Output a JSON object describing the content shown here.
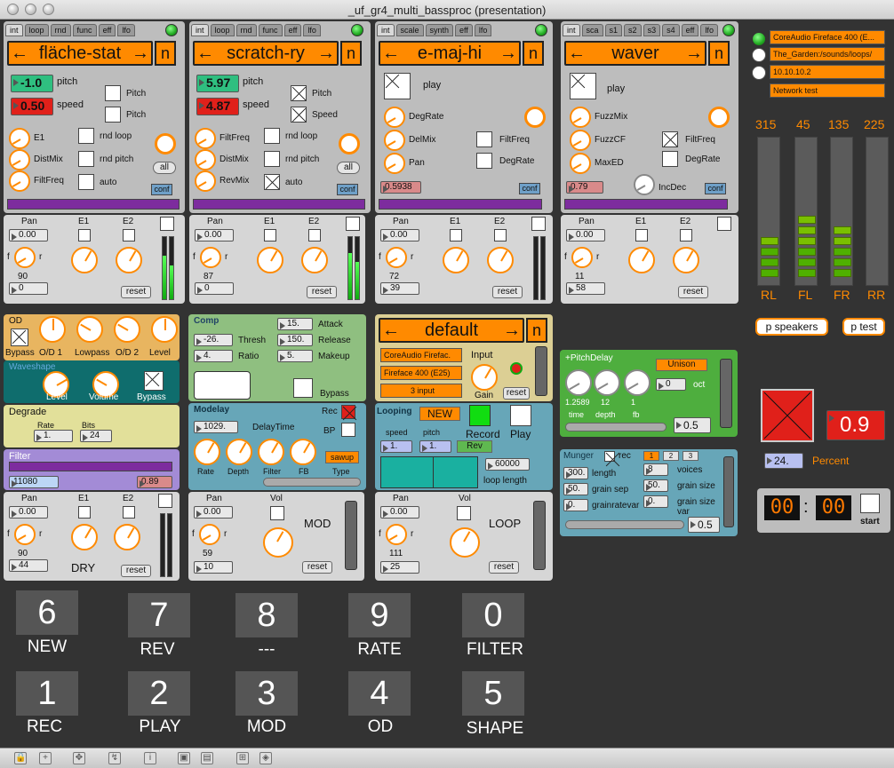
{
  "window": {
    "title": "_uf_gr4_multi_bassproc (presentation)"
  },
  "colors": {
    "accent": "#ff8a00",
    "meter": "#33cc33",
    "panel_gray": "#bdbdbd"
  },
  "modules": [
    {
      "tabs": [
        "int",
        "loop",
        "rnd",
        "func",
        "eff",
        "lfo"
      ],
      "name": "fläche-stat",
      "n": "n",
      "val1": "-1.0",
      "val1_label": "pitch",
      "val2": "0.50",
      "val2_label": "speed",
      "chk_labels": [
        "Pitch",
        "Pitch"
      ],
      "knob_labels": [
        "E1",
        "DistMix",
        "FiltFreq"
      ],
      "opts": [
        "rnd loop",
        "rnd pitch",
        "auto"
      ],
      "all": "all",
      "conf": "conf",
      "pan": "Pan",
      "pan_val": "0.00",
      "e1": "E1",
      "e2": "E2",
      "f": "f",
      "r": "r",
      "knob_val": "90",
      "vol_val": "0",
      "reset": "reset"
    },
    {
      "tabs": [
        "int",
        "loop",
        "rnd",
        "func",
        "eff",
        "lfo"
      ],
      "name": "scratch-ry",
      "n": "n",
      "val1": "5.97",
      "val1_label": "pitch",
      "val2": "4.87",
      "val2_label": "speed",
      "chk_labels": [
        "Pitch",
        "Speed"
      ],
      "knob_labels": [
        "FiltFreq",
        "DistMix",
        "RevMix"
      ],
      "opts": [
        "rnd loop",
        "rnd pitch",
        "auto"
      ],
      "all": "all",
      "conf": "conf",
      "pan": "Pan",
      "pan_val": "0.00",
      "e1": "E1",
      "e2": "E2",
      "f": "f",
      "r": "r",
      "knob_val": "87",
      "vol_val": "0",
      "reset": "reset"
    },
    {
      "tabs": [
        "int",
        "scale",
        "synth",
        "eff",
        "lfo"
      ],
      "name": "e-maj-hi",
      "n": "n",
      "play": "play",
      "knob_labels": [
        "DegRate",
        "DelMix",
        "Pan"
      ],
      "opts": [
        "FiltFreq",
        "DegRate"
      ],
      "small_val": "0.5938",
      "conf": "conf",
      "pan": "Pan",
      "pan_val": "0.00",
      "e1": "E1",
      "e2": "E2",
      "f": "f",
      "r": "r",
      "knob_val": "72",
      "vol_val": "39",
      "reset": "reset"
    },
    {
      "tabs": [
        "int",
        "sca",
        "s1",
        "s2",
        "s3",
        "s4",
        "eff",
        "lfo"
      ],
      "name": "waver",
      "n": "n",
      "play": "play",
      "knob_labels": [
        "FuzzMix",
        "FuzzCF",
        "MaxED"
      ],
      "opts": [
        "FiltFreq",
        "DegRate"
      ],
      "small_val": "0.79",
      "incdec": "IncDec",
      "conf": "conf",
      "pan": "Pan",
      "pan_val": "0.00",
      "e1": "E1",
      "e2": "E2",
      "f": "f",
      "r": "r",
      "knob_val": "11",
      "vol_val": "58",
      "reset": "reset"
    }
  ],
  "audio": {
    "device": "CoreAudio Fireface 400 (E...",
    "path": "The_Garden:/sounds/loops/",
    "ip": "10.10.10.2",
    "net": "Network test"
  },
  "speakers": [
    {
      "angle": "315",
      "label": "RL",
      "level": 0.35
    },
    {
      "angle": "45",
      "label": "FL",
      "level": 0.45
    },
    {
      "angle": "135",
      "label": "FR",
      "level": 0.35
    },
    {
      "angle": "225",
      "label": "RR",
      "level": 0
    }
  ],
  "speaker_buttons": {
    "speakers": "p speakers",
    "test": "p test"
  },
  "od": {
    "title": "OD",
    "labels": [
      "Bypass",
      "O/D 1",
      "Lowpass",
      "O/D 2",
      "Level"
    ]
  },
  "waveshape": {
    "title": "Waveshape",
    "labels": [
      "Level",
      "Volume",
      "Bypass"
    ]
  },
  "degrade": {
    "title": "Degrade",
    "rate_label": "Rate",
    "bits_label": "Bits",
    "rate": "1.",
    "bits": "24"
  },
  "filter": {
    "title": "Filter",
    "freq": "11080",
    "q": "0.89"
  },
  "dry": {
    "pan": "Pan",
    "pan_val": "0.00",
    "e1": "E1",
    "e2": "E2",
    "f": "f",
    "r": "r",
    "knob_val": "90",
    "vol_val": "44",
    "label": "DRY",
    "reset": "reset"
  },
  "comp": {
    "title": "Comp",
    "thresh": "-26.",
    "thresh_label": "Thresh",
    "ratio": "4.",
    "ratio_label": "Ratio",
    "attack": "15.",
    "attack_label": "Attack",
    "release": "150.",
    "release_label": "Release",
    "makeup": "5.",
    "makeup_label": "Makeup",
    "bypass": "Bypass"
  },
  "modelay": {
    "title": "Modelay",
    "time": "1029.",
    "time_label": "DelayTime",
    "rec": "Rec",
    "bp": "BP",
    "knobs": [
      "Rate",
      "Depth",
      "Filter",
      "FB"
    ],
    "type": "sawup",
    "type_label": "Type"
  },
  "mod": {
    "pan": "Pan",
    "pan_val": "0.00",
    "vol": "Vol",
    "f": "f",
    "r": "r",
    "knob_val": "59",
    "vol_val": "10",
    "label": "MOD",
    "reset": "reset"
  },
  "preset": {
    "name": "default",
    "n": "n",
    "dev1": "CoreAudio Firefac.",
    "dev2": "Fireface 400 (E25)",
    "inputs": "3 input",
    "input_label": "Input",
    "gain": "Gain",
    "reset": "reset"
  },
  "looping": {
    "title": "Looping",
    "new": "NEW",
    "record": "Record",
    "play": "Play",
    "speed": "speed",
    "pitch": "pitch",
    "speed_val": "1.",
    "pitch_val": "1.",
    "rev": "Rev",
    "length": "60000",
    "length_label": "loop length"
  },
  "loop": {
    "pan": "Pan",
    "pan_val": "0.00",
    "vol": "Vol",
    "f": "f",
    "r": "r",
    "knob_val": "111",
    "vol_val": "25",
    "label": "LOOP",
    "reset": "reset"
  },
  "pitchdelay": {
    "title": "+PitchDelay",
    "mode": "Unison",
    "oct_val": "0",
    "oct": "oct",
    "vals": [
      "1.2589",
      "12",
      "1"
    ],
    "labels": [
      "time",
      "depth",
      "fb"
    ],
    "out": "0.5"
  },
  "munger": {
    "title": "Munger",
    "rec": "rec",
    "tabs": [
      "1",
      "2",
      "3"
    ],
    "length": "300.",
    "length_label": "length",
    "sep": "50.",
    "sep_label": "grain sep",
    "rv": "0.",
    "rv_label": "grainratevar",
    "voices": "8",
    "voices_label": "voices",
    "gsize": "50.",
    "gsize_label": "grain size",
    "gsv": "0.",
    "gsv_label": "grain size var",
    "out": "0.5"
  },
  "master": {
    "value": "0.9",
    "percent": "24.",
    "percent_label": "Percent"
  },
  "clock": {
    "min": "00",
    "sep": ":",
    "sec": "00",
    "start": "start"
  },
  "keys": [
    {
      "key": "6",
      "label": "NEW"
    },
    {
      "key": "7",
      "label": "REV"
    },
    {
      "key": "8",
      "label": "---"
    },
    {
      "key": "9",
      "label": "RATE"
    },
    {
      "key": "0",
      "label": "FILTER"
    },
    {
      "key": "1",
      "label": "REC"
    },
    {
      "key": "2",
      "label": "PLAY"
    },
    {
      "key": "3",
      "label": "MOD"
    },
    {
      "key": "4",
      "label": "OD"
    },
    {
      "key": "5",
      "label": "SHAPE"
    }
  ]
}
